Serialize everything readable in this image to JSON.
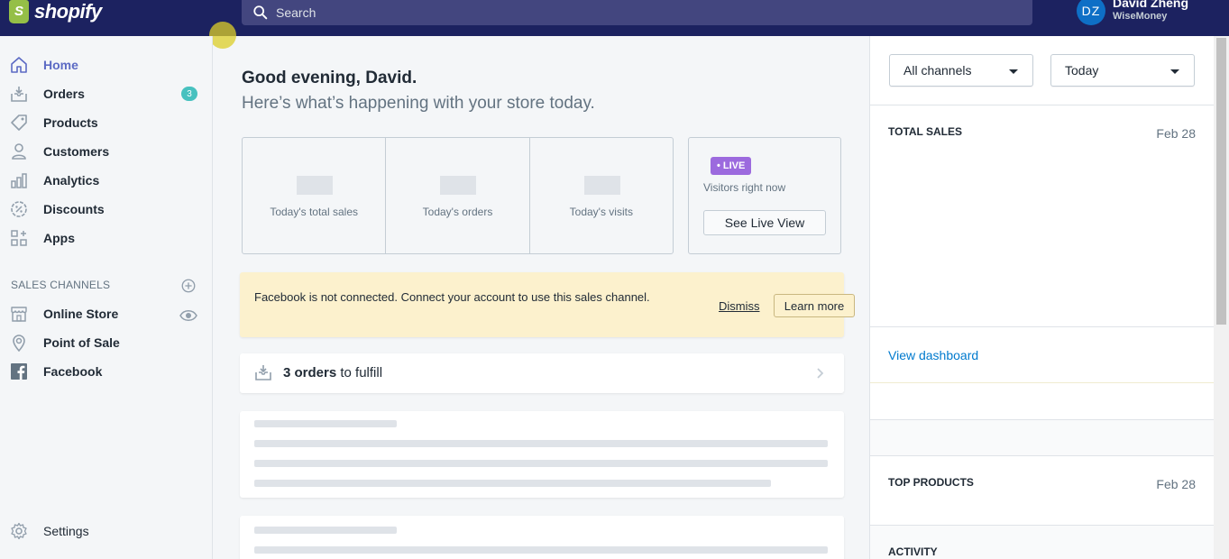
{
  "topbar": {
    "logo_text": "shopify",
    "search_placeholder": "Search",
    "user_initials": "DZ",
    "user_name": "David Zheng",
    "store_name": "WiseMoney"
  },
  "sidebar": {
    "items": [
      {
        "label": "Home",
        "icon": "home-icon",
        "active": true
      },
      {
        "label": "Orders",
        "icon": "orders-icon",
        "badge": "3"
      },
      {
        "label": "Products",
        "icon": "tag-icon"
      },
      {
        "label": "Customers",
        "icon": "person-icon"
      },
      {
        "label": "Analytics",
        "icon": "bar-chart-icon"
      },
      {
        "label": "Discounts",
        "icon": "discount-icon"
      },
      {
        "label": "Apps",
        "icon": "apps-icon"
      }
    ],
    "channels_title": "SALES CHANNELS",
    "channels": [
      {
        "label": "Online Store",
        "icon": "store-icon"
      },
      {
        "label": "Point of Sale",
        "icon": "location-pin-icon"
      },
      {
        "label": "Facebook",
        "icon": "facebook-icon"
      }
    ],
    "settings_label": "Settings"
  },
  "main": {
    "greeting": "Good evening, David.",
    "subgreeting": "Here’s what’s happening with your store today.",
    "stats": [
      {
        "caption": "Today's total sales"
      },
      {
        "caption": "Today's orders"
      },
      {
        "caption": "Today's visits"
      }
    ],
    "live": {
      "badge": "• LIVE",
      "text": "Visitors right now",
      "button": "See Live View"
    },
    "banner": {
      "text": "Facebook is not connected. Connect your account to use this sales channel.",
      "dismiss": "Dismiss",
      "learn_more": "Learn more"
    },
    "fulfill": {
      "count": "3 orders",
      "suffix": " to fulfill"
    }
  },
  "right_panel": {
    "channels_select": "All channels",
    "period_select": "Today",
    "total_sales_title": "TOTAL SALES",
    "total_sales_date": "Feb 28",
    "view_dashboard": "View dashboard",
    "top_products_title": "TOP PRODUCTS",
    "top_products_date": "Feb 28",
    "activity_title": "ACTIVITY"
  },
  "colors": {
    "topbar": "#1c2260",
    "accent": "#5c6ac4",
    "badge": "#47c1bf",
    "live": "#9c6ade",
    "banner": "#fcf1cd",
    "link": "#007ace"
  }
}
